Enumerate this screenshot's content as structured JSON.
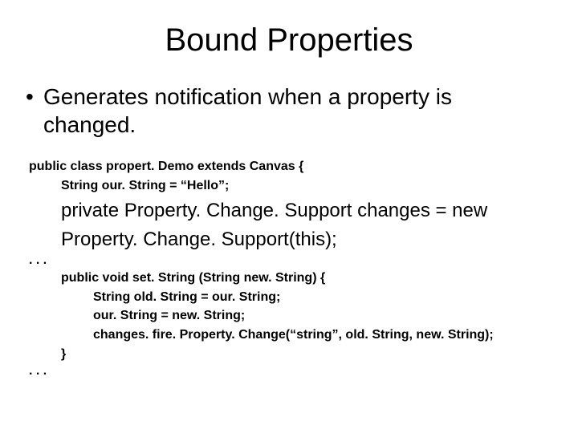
{
  "title": "Bound Properties",
  "bullet": "Generates notification when a property is changed.",
  "code": {
    "decl": "public class propert. Demo extends Canvas {",
    "str": "String our. String = “Hello”;",
    "priv1": "private Property. Change. Support changes = new",
    "priv2": "Property. Change. Support(this);",
    "ell1": ". . .",
    "set": "public void set. String (String new. String) {",
    "old": "String old. String = our. String;",
    "assign": "our. String = new. String;",
    "fire": "changes. fire. Property. Change(“string”, old. String, new. String);",
    "close": "}",
    "ell2": ". . ."
  }
}
